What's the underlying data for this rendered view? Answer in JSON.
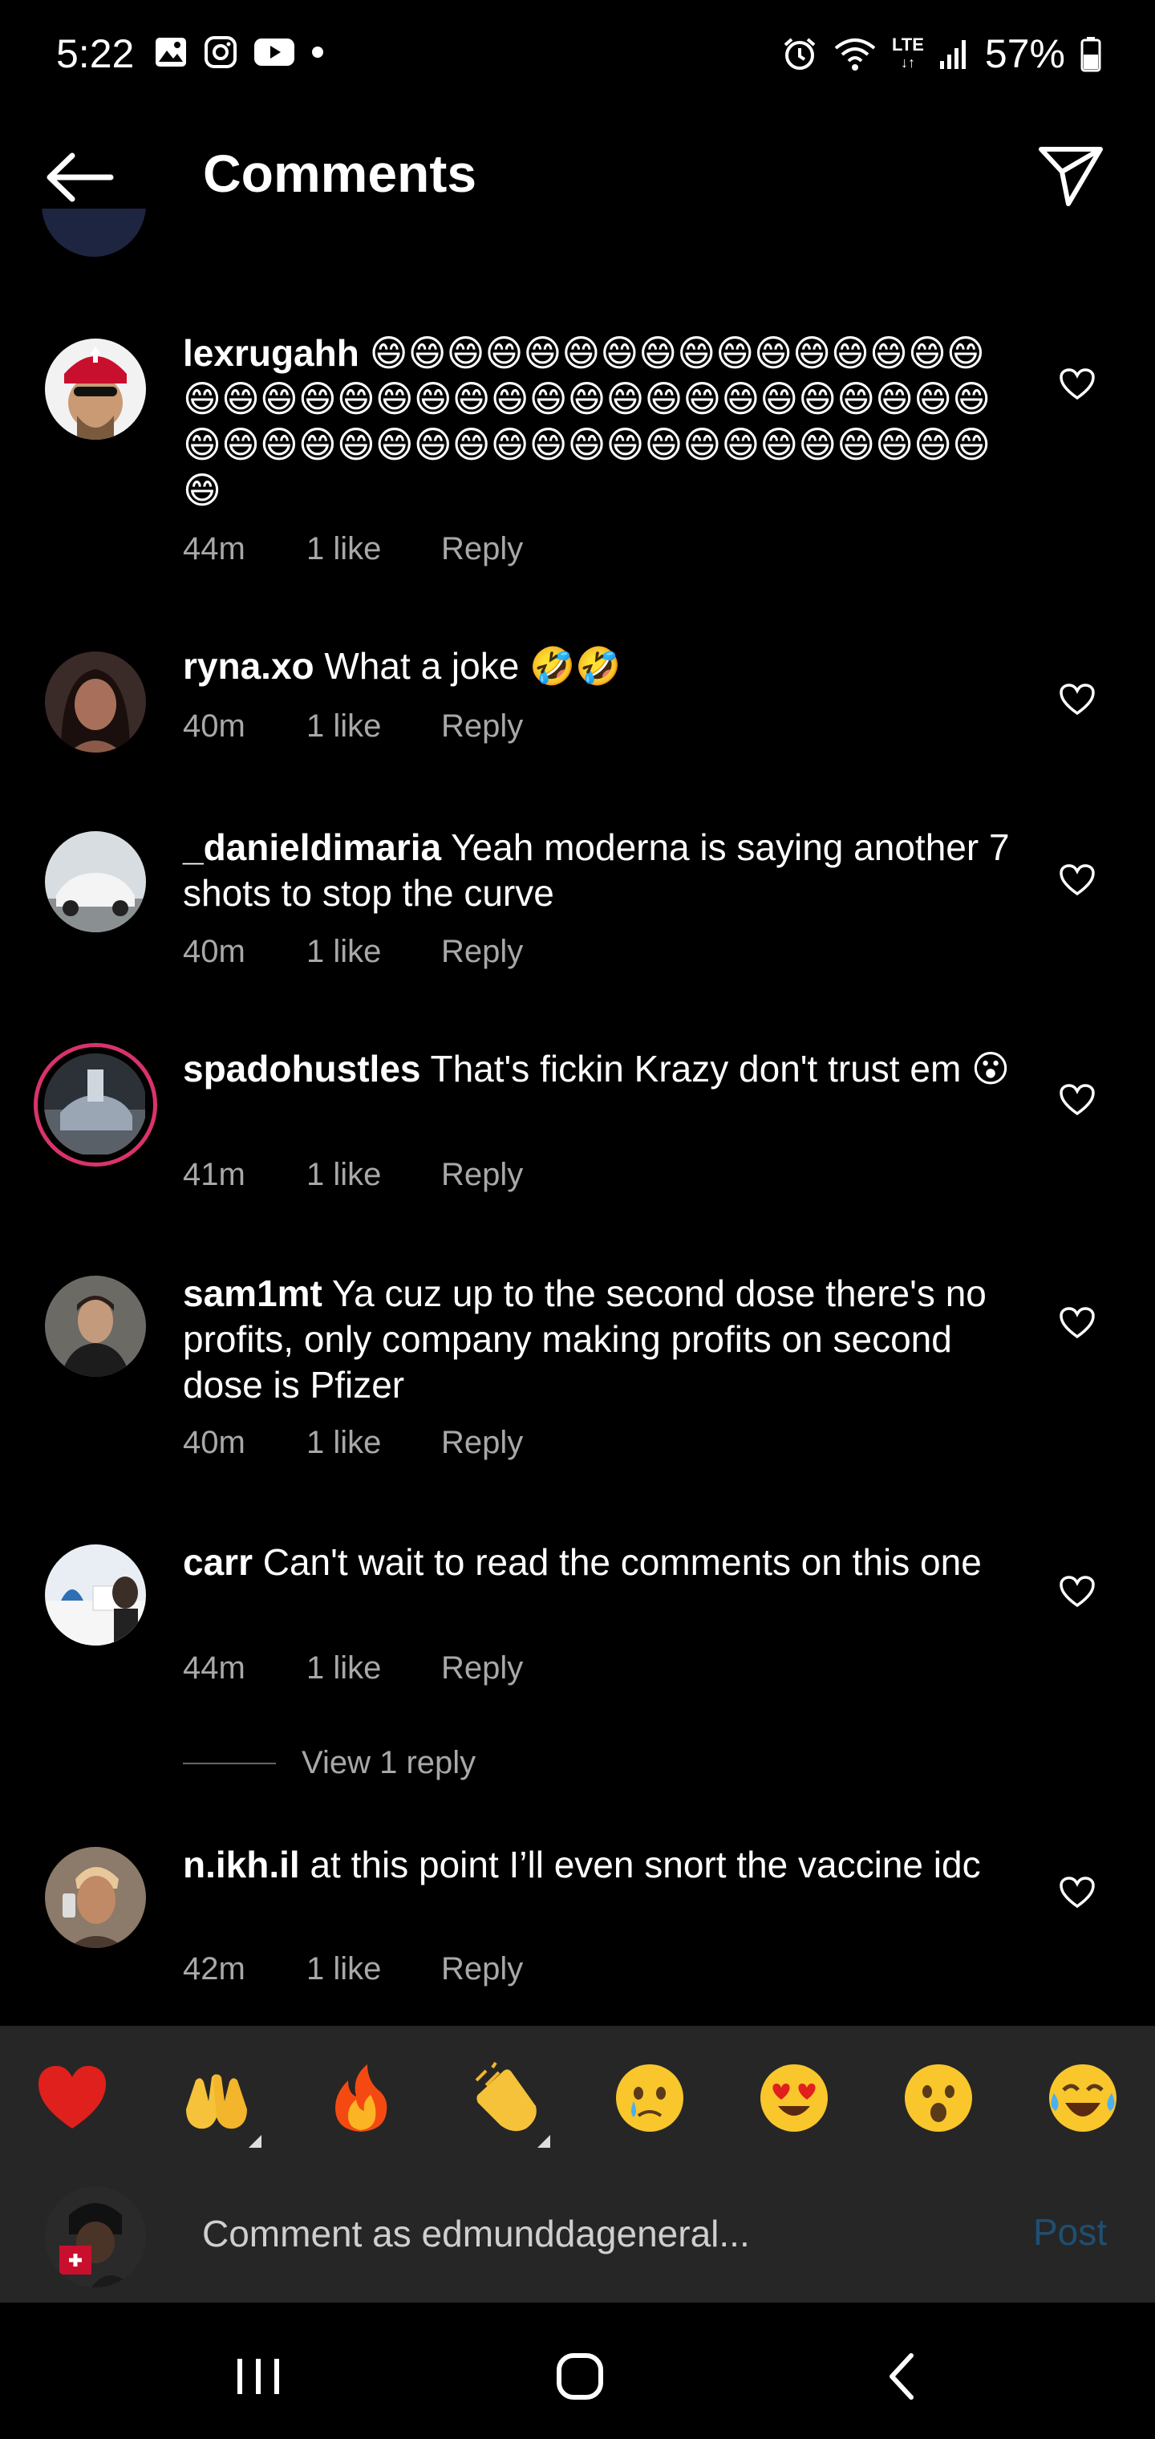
{
  "status_bar": {
    "time": "5:22",
    "network": "LTE",
    "battery": "57%",
    "icons": [
      "gallery-icon",
      "instagram-icon",
      "youtube-icon",
      "dot-icon",
      "alarm-icon",
      "wifi-icon",
      "lte-icon",
      "signal-icon",
      "battery-icon"
    ]
  },
  "header": {
    "title": "Comments",
    "back_icon": "back-arrow-icon",
    "share_icon": "send-icon"
  },
  "comments": [
    {
      "username": "lexrugahh",
      "text": "😄😄😄😄😄😄😄😄😄😄😄😄😄😄😄😄😄😄😄😄😄😄😄😄😄😄😄😄😄😄😄😄😄😄😄😄😄😄😄😄😄😄😄😄😄😄😄😄😄😄😄😄😄😄😄😄😄😄😄",
      "time": "44m",
      "likes": "1 like",
      "reply": "Reply"
    },
    {
      "username": "ryna.xo",
      "text": "What a joke 🤣🤣",
      "time": "40m",
      "likes": "1 like",
      "reply": "Reply"
    },
    {
      "username": "_danieldimaria",
      "text": "Yeah moderna is saying another 7 shots to stop the curve",
      "time": "40m",
      "likes": "1 like",
      "reply": "Reply"
    },
    {
      "username": "spadohustles",
      "text": "That's fickin Krazy don't trust em 😮",
      "time": "41m",
      "likes": "1 like",
      "reply": "Reply"
    },
    {
      "username": "sam1mt",
      "text": "Ya cuz up to the second dose there's no profits, only company making profits on second dose is Pfizer",
      "time": "40m",
      "likes": "1 like",
      "reply": "Reply"
    },
    {
      "username": "carr",
      "text": "Can't wait to read the comments on this one",
      "time": "44m",
      "likes": "1 like",
      "reply": "Reply"
    },
    {
      "username": "n.ikh.il",
      "text": "at this point I’ll even snort the vaccine idc",
      "time": "42m",
      "likes": "1 like",
      "reply": "Reply"
    }
  ],
  "view_replies": "View 1 reply",
  "emoji_bar": [
    "❤️",
    "🙌",
    "🔥",
    "👏",
    "😢",
    "😍",
    "😮",
    "😂"
  ],
  "composer": {
    "placeholder": "Comment as edmunddageneral...",
    "post_label": "Post"
  },
  "nav_bar": [
    "recent-apps-icon",
    "home-icon",
    "back-icon"
  ]
}
